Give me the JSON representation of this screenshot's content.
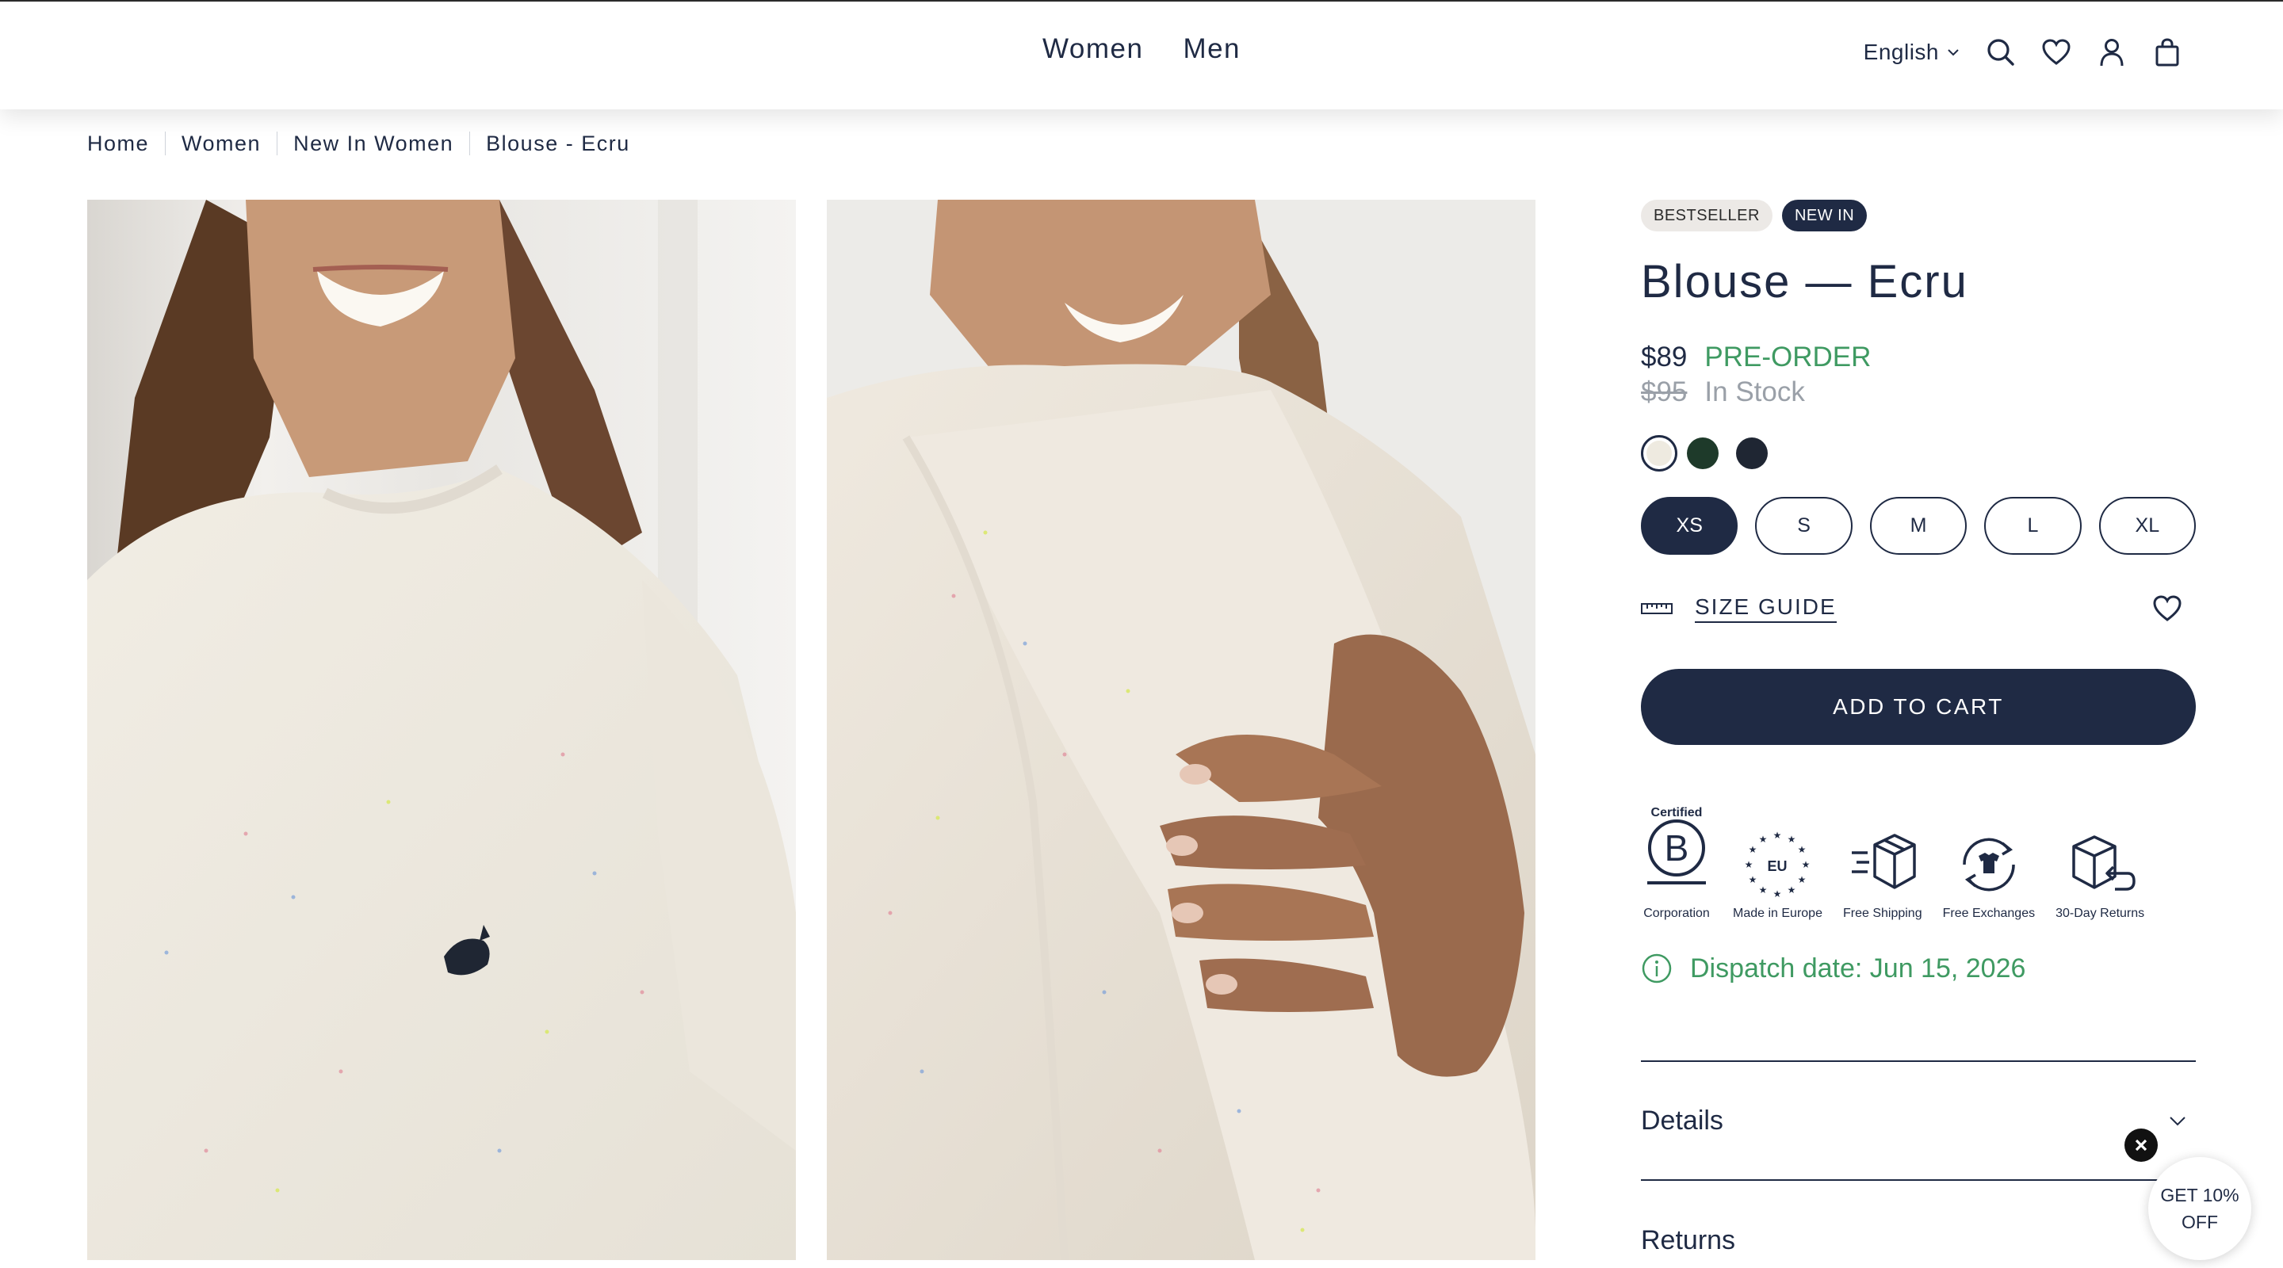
{
  "header": {
    "nav": [
      {
        "label": "Women"
      },
      {
        "label": "Men"
      }
    ],
    "language": "English",
    "icons": [
      "search-icon",
      "heart-icon",
      "user-icon",
      "bag-icon"
    ]
  },
  "breadcrumb": [
    "Home",
    "Women",
    "New In Women",
    "Blouse - Ecru"
  ],
  "product": {
    "badges": [
      "BESTSELLER",
      "NEW IN"
    ],
    "title": "Blouse — Ecru",
    "price": "$89",
    "preorder": "PRE-ORDER",
    "old_price": "$95",
    "stock": "In Stock",
    "colors": [
      "#eeeae0",
      "#1e3a2a",
      "#1f2633"
    ],
    "selected_color": 0,
    "sizes": [
      "XS",
      "S",
      "M",
      "L",
      "XL"
    ],
    "selected_size": "XS",
    "size_guide": "SIZE GUIDE",
    "add_to_cart": "ADD TO CART",
    "features": [
      {
        "label": "Corporation",
        "top": "Certified",
        "icon": "b-corp-icon"
      },
      {
        "label": "Made in Europe",
        "top": "EU",
        "icon": "eu-stars-icon"
      },
      {
        "label": "Free Shipping",
        "icon": "box-icon"
      },
      {
        "label": "Free Exchanges",
        "icon": "tshirt-exchange-icon"
      },
      {
        "label": "30-Day Returns",
        "icon": "box-return-icon"
      }
    ],
    "dispatch": "Dispatch date: Jun 15, 2026",
    "accordion": [
      "Details",
      "Returns"
    ]
  },
  "popup": {
    "line1": "GET 10%",
    "line2": "OFF"
  },
  "colors": {
    "navy": "#1f2a44",
    "green": "#3f9a62",
    "grey": "#9aa0a8"
  }
}
